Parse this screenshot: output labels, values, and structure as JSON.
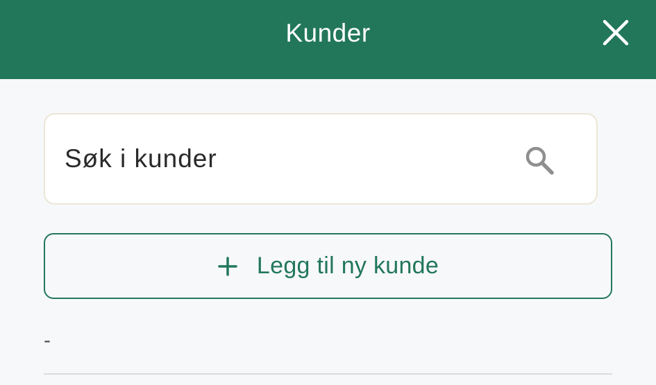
{
  "header": {
    "title": "Kunder",
    "close_icon": "close-icon"
  },
  "search": {
    "placeholder": "Søk i kunder",
    "value": "",
    "icon": "search-icon"
  },
  "add_button": {
    "label": "Legg til ny kunde",
    "icon": "plus-icon"
  },
  "customers": [
    {
      "name": "-"
    }
  ],
  "colors": {
    "accent": "#22775a",
    "background": "#f7f8fa",
    "search_border": "#ebe6d6",
    "divider": "#d9dcdf"
  }
}
